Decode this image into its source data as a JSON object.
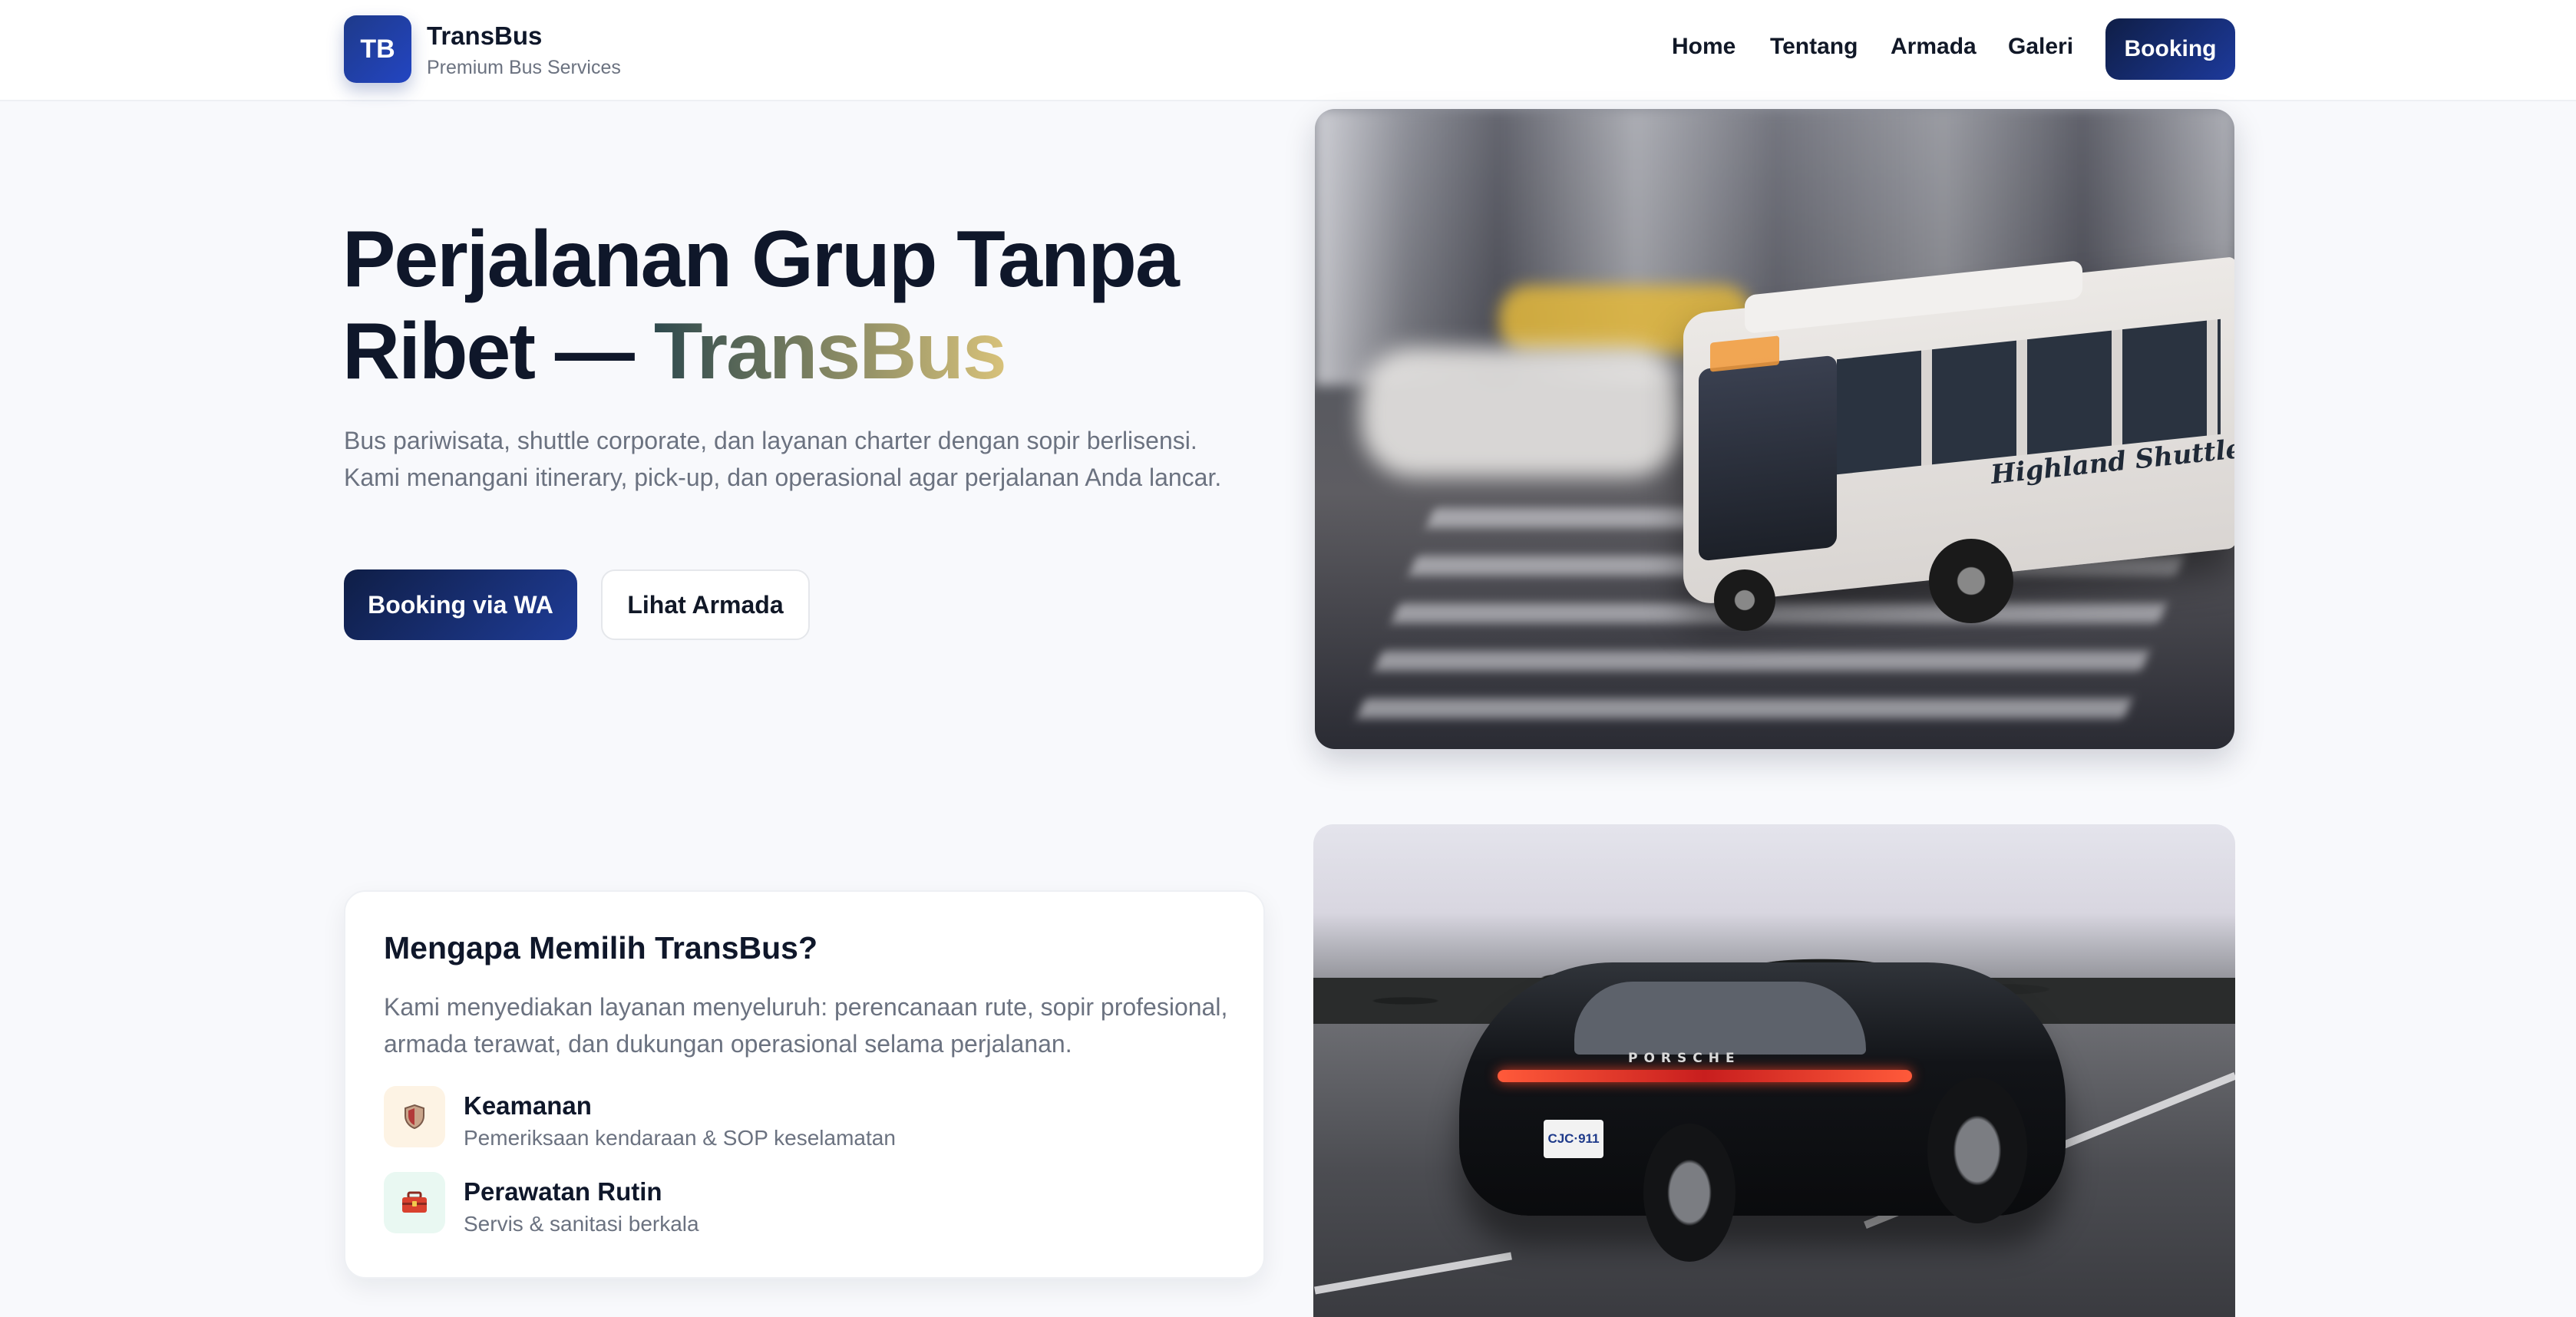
{
  "header": {
    "logo_initials": "TB",
    "brand_name": "TransBus",
    "brand_tagline": "Premium Bus Services",
    "nav": {
      "home": "Home",
      "tentang": "Tentang",
      "armada": "Armada",
      "galeri": "Galeri"
    },
    "booking_button": "Booking"
  },
  "hero": {
    "title_line1": "Perjalanan Grup Tanpa",
    "title_line2_prefix": "Ribet —",
    "title_accent": "TransBus",
    "description": "Bus pariwisata, shuttle corporate, dan layanan charter dengan sopir berlisensi. Kami menangani itinerary, pick-up, dan operasional agar perjalanan Anda lancar.",
    "primary_button": "Booking via WA",
    "secondary_button": "Lihat Armada",
    "image": {
      "bus_label": "Highland Shuttle"
    }
  },
  "why": {
    "title": "Mengapa Memilih TransBus?",
    "description": "Kami menyediakan layanan menyeluruh: perencanaan rute, sopir profesional, armada terawat, dan dukungan operasional selama perjalanan.",
    "features": [
      {
        "icon": "shield-icon",
        "title": "Keamanan",
        "subtitle": "Pemeriksaan kendaraan & SOP keselamatan"
      },
      {
        "icon": "toolbox-icon",
        "title": "Perawatan Rutin",
        "subtitle": "Servis & sanitasi berkala"
      }
    ]
  },
  "gallery": {
    "car_brand": "PORSCHE",
    "car_plate": "CJC·911"
  },
  "colors": {
    "primary_dark": "#0f1e46",
    "primary_blue": "#1d3a9c",
    "accent_gold": "#d8c27a",
    "accent_teal": "#2f4a4e",
    "text_dark": "#0f172a",
    "text_muted": "#6b7280",
    "background": "#f8f9fc"
  }
}
